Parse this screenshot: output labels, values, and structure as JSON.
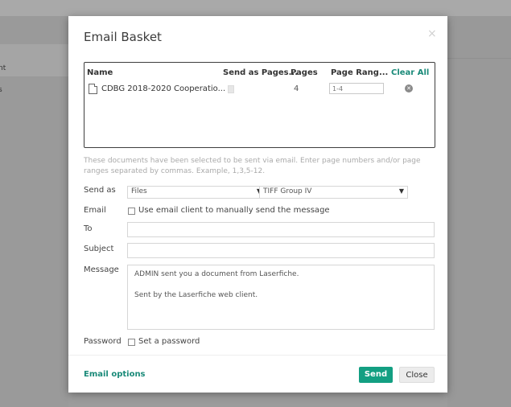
{
  "background": {
    "side_text_1": "nt",
    "side_text_2": "s"
  },
  "dialog": {
    "title": "Email Basket",
    "close_glyph": "×"
  },
  "grid": {
    "headers": {
      "name": "Name",
      "send_as": "Send as Pages...",
      "pages": "Pages",
      "page_range": "Page Rang...",
      "clear_all": "Clear All"
    },
    "rows": [
      {
        "name": "CDBG 2018-2020 Cooperatio...",
        "pages": "4",
        "page_range": "1-4"
      }
    ]
  },
  "info_text": "These documents have been selected to be sent via email. Enter page numbers and/or page ranges separated by commas. Example, 1,3,5-12.",
  "form": {
    "send_as_label": "Send as",
    "send_as_type": "Files",
    "send_as_format": "TIFF Group IV",
    "email_label": "Email",
    "email_client_option": "Use email client to manually send the message",
    "to_label": "To",
    "to_value": "",
    "subject_label": "Subject",
    "subject_value": "",
    "message_label": "Message",
    "message_line1": "ADMIN sent you a document from Laserfiche.",
    "message_line2": "Sent by the Laserfiche web client.",
    "password_label": "Password",
    "password_option": "Set a password"
  },
  "footer": {
    "email_options": "Email options",
    "send": "Send",
    "close": "Close"
  },
  "colors": {
    "accent": "#139f82",
    "link": "#1a8a79"
  }
}
